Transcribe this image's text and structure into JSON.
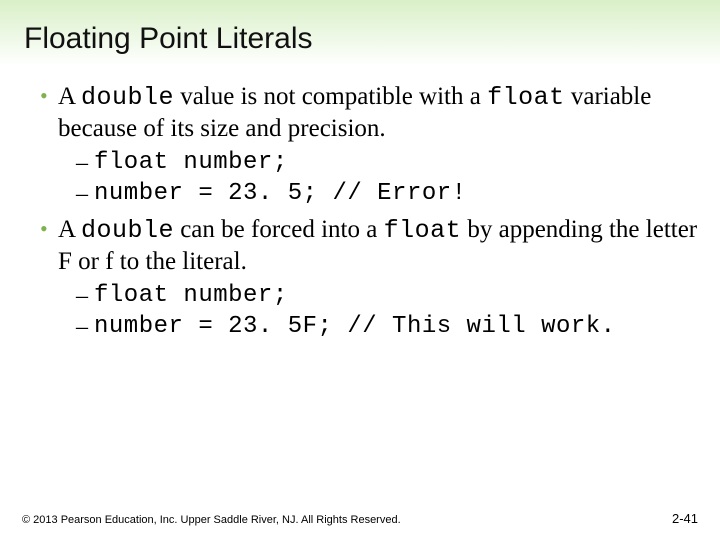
{
  "title": "Floating Point Literals",
  "bullets": [
    {
      "segments": [
        {
          "t": "A ",
          "mono": false
        },
        {
          "t": "double",
          "mono": true
        },
        {
          "t": " value is not compatible with a ",
          "mono": false
        },
        {
          "t": "float",
          "mono": true
        },
        {
          "t": " variable because of its size and precision.",
          "mono": false
        }
      ],
      "code": [
        "float number;",
        "number = 23. 5; // Error!"
      ]
    },
    {
      "segments": [
        {
          "t": "A ",
          "mono": false
        },
        {
          "t": "double",
          "mono": true
        },
        {
          "t": " can be forced into a ",
          "mono": false
        },
        {
          "t": "float",
          "mono": true
        },
        {
          "t": " by appending the letter F or f to the literal.",
          "mono": false
        }
      ],
      "code": [
        "float number;",
        "number = 23. 5F; // This will work."
      ]
    }
  ],
  "footer": {
    "copyright": "© 2013 Pearson Education, Inc. Upper Saddle River, NJ. All Rights Reserved.",
    "pagenum": "2-41"
  }
}
